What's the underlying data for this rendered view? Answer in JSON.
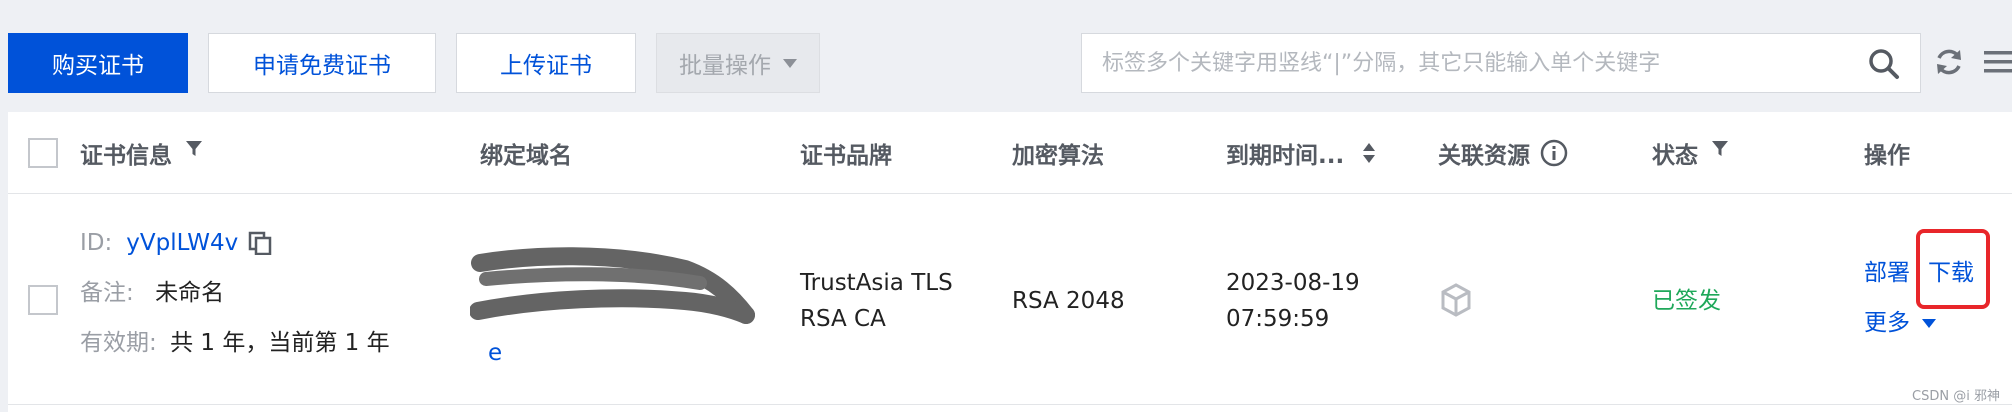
{
  "toolbar": {
    "buy_label": "购买证书",
    "apply_free_label": "申请免费证书",
    "upload_label": "上传证书",
    "batch_label": "批量操作",
    "search_placeholder": "标签多个关键字用竖线“|”分隔，其它只能输入单个关键字",
    "search_icon": "search-icon",
    "refresh_icon": "refresh-icon",
    "menu_icon": "list-icon"
  },
  "table": {
    "columns": {
      "cert_info": "证书信息",
      "domain": "绑定域名",
      "brand": "证书品牌",
      "algorithm": "加密算法",
      "expiry": "到期时间...",
      "resources": "关联资源",
      "status": "状态",
      "actions": "操作"
    },
    "rows": [
      {
        "id_label": "ID:",
        "id_value": "yVplLW4v",
        "note_label": "备注:",
        "note_value": "未命名",
        "validity_label": "有效期:",
        "validity_value": "共 1 年，当前第 1 年",
        "domain_tail": "e",
        "brand_line1": "TrustAsia TLS",
        "brand_line2": "RSA CA",
        "algorithm": "RSA 2048",
        "expiry_date": "2023-08-19",
        "expiry_time": "07:59:59",
        "status": "已签发",
        "action_deploy": "部署",
        "action_download": "下载",
        "action_more": "更多"
      }
    ]
  },
  "colors": {
    "primary": "#0052d9",
    "status_ok": "#1fa85a",
    "highlight": "#e8262a"
  },
  "watermark": "CSDN @i 邪神"
}
